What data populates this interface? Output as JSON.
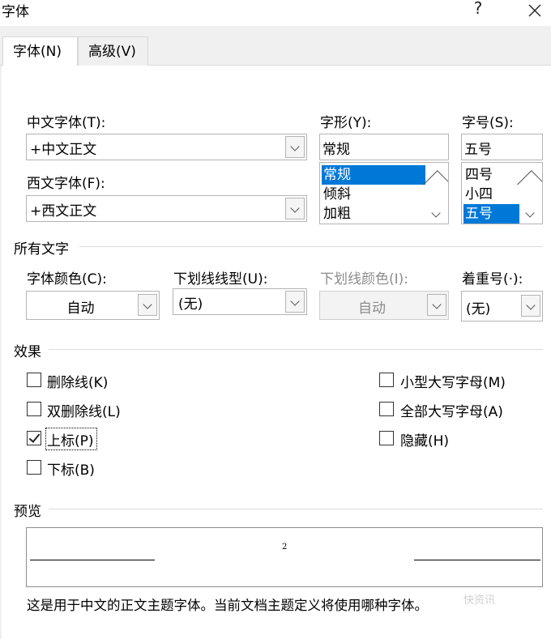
{
  "window": {
    "title": "字体",
    "help_glyph": "?",
    "close_glyph": "✕"
  },
  "tabs": [
    {
      "label": "字体(N)",
      "active": true
    },
    {
      "label": "高级(V)",
      "active": false
    }
  ],
  "fonts": {
    "chinese_label": "中文字体(T):",
    "chinese_value": "+中文正文",
    "western_label": "西文字体(F):",
    "western_value": "+西文正文"
  },
  "style": {
    "label": "字形(Y):",
    "value": "常规",
    "options": [
      "常规",
      "倾斜",
      "加粗"
    ],
    "selected": "常规"
  },
  "size": {
    "label": "字号(S):",
    "value": "五号",
    "options": [
      "四号",
      "小四",
      "五号"
    ],
    "selected": "五号"
  },
  "all_text": {
    "section_label": "所有文字",
    "font_color_label": "字体颜色(C):",
    "font_color_value": "自动",
    "underline_style_label": "下划线线型(U):",
    "underline_style_value": "(无)",
    "underline_color_label": "下划线颜色(I):",
    "underline_color_value": "自动",
    "emphasis_label": "着重号(·):",
    "emphasis_value": "(无)"
  },
  "effects": {
    "section_label": "效果",
    "left": [
      {
        "label": "删除线(K)",
        "checked": false
      },
      {
        "label": "双删除线(L)",
        "checked": false
      },
      {
        "label": "上标(P)",
        "checked": true
      },
      {
        "label": "下标(B)",
        "checked": false
      }
    ],
    "right": [
      {
        "label": "小型大写字母(M)",
        "checked": false
      },
      {
        "label": "全部大写字母(A)",
        "checked": false
      },
      {
        "label": "隐藏(H)",
        "checked": false
      }
    ]
  },
  "preview": {
    "section_label": "预览",
    "sample_text": "2",
    "description": "这是用于中文的正文主题字体。当前文档主题定义将使用哪种字体。"
  },
  "watermark": "快资讯"
}
